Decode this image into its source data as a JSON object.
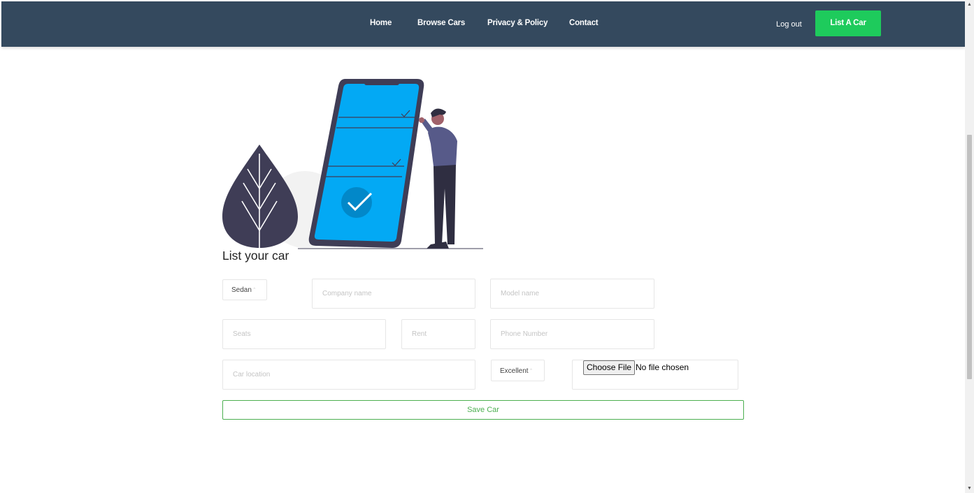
{
  "nav": {
    "links": [
      "Home",
      "Browse Cars",
      "Privacy & Policy",
      "Contact"
    ],
    "logout": "Log out",
    "list_car": "List A Car"
  },
  "form": {
    "heading": "List your car",
    "car_type": "Sedan",
    "company_placeholder": "Company name",
    "model_placeholder": "Model name",
    "seats_placeholder": "Seats",
    "rent_placeholder": "Rent",
    "phone_placeholder": "Phone Number",
    "location_placeholder": "Car location",
    "condition": "Excellent",
    "file_button": "Choose File",
    "file_status": "No file chosen",
    "save_button": "Save Car"
  },
  "colors": {
    "navbar": "#34495e",
    "accent_green": "#1ecb5c",
    "save_outline": "#4caf50",
    "phone_screen": "#03a9f4",
    "illustration_dark": "#3f3d56"
  }
}
